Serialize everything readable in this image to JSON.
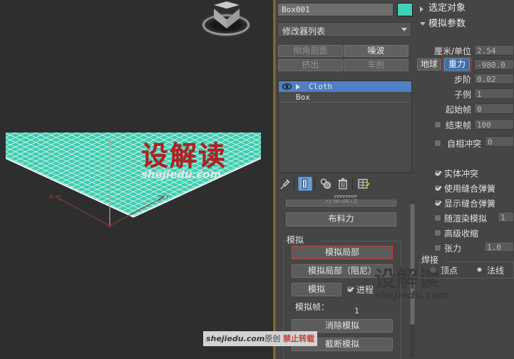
{
  "viewport": {
    "name": "perspective-viewport",
    "viewcube_label": "view-cube",
    "axis_z": "Z",
    "axis_x": "X",
    "axis_y": "Y",
    "mesh_color": "#3fcdb0",
    "mesh_edge_color": "#ffffff",
    "background": "#2e2e2e",
    "watermark_cn": "设解读",
    "watermark_en": "shejiedu.com"
  },
  "bottom_watermark": {
    "en": "shejiedu.com",
    "cn": "原创",
    "red": "禁止转载"
  },
  "command_panel": {
    "object_name": "Box001",
    "object_color": "#3fd3b4",
    "modifier_list_label": "修改器列表",
    "modifier_buttons": [
      {
        "label": "倒角剖面",
        "enabled": false
      },
      {
        "label": "噪波",
        "enabled": true
      },
      {
        "label": "挤出",
        "enabled": false
      },
      {
        "label": "车削",
        "enabled": false
      }
    ],
    "stack": [
      {
        "label": "Cloth",
        "selected": true,
        "has_eye": true,
        "has_expand": true
      },
      {
        "label": "Box",
        "selected": false,
        "has_eye": false,
        "has_expand": false
      }
    ],
    "stack_tools": [
      {
        "name": "pin-stack-icon",
        "active": false
      },
      {
        "name": "show-end-result-icon",
        "active": true
      },
      {
        "name": "make-unique-icon",
        "active": false
      },
      {
        "name": "remove-modifier-icon",
        "active": false
      },
      {
        "name": "configure-modifier-sets-icon",
        "active": false
      }
    ],
    "object_properties_button": "对象属性",
    "cloth_forces_button": "布料力",
    "simulation_group": "模拟",
    "simulate_local_button": "模拟局部",
    "simulate_local_damped_button": "模拟局部（阻尼）",
    "simulate_button": "模拟",
    "progress_checkbox_label": "进程",
    "progress_checked": true,
    "sim_frame_label": "模拟帧：",
    "sim_frame_value": "1",
    "erase_simulation_button": "消除模拟",
    "truncate_simulation_button": "截断模拟",
    "highlight_color": "#e03535"
  },
  "param_panel": {
    "rollout_selected_object": "选定对象",
    "rollout_sim_params": "模拟参数",
    "cm_per_unit_label": "厘米/单位",
    "cm_per_unit_value": "2.54",
    "earth_button": "地球",
    "gravity_button": "重力",
    "gravity_value": "-980.0",
    "step_label": "步阶",
    "step_value": "0.02",
    "subsample_label": "子例",
    "subsample_value": "1",
    "start_frame_label": "起始帧",
    "start_frame_value": "0",
    "end_frame_label": "结束帧",
    "end_frame_value": "100",
    "end_frame_checked": false,
    "self_collision_label": "自相冲突",
    "self_collision_value": "0",
    "self_collision_checked": false,
    "solid_collision_label": "实体冲突",
    "solid_collision_checked": true,
    "use_sewing_springs_label": "使用缝合弹簧",
    "use_sewing_springs_checked": true,
    "show_sewing_springs_label": "显示缝合弹簧",
    "show_sewing_springs_checked": true,
    "sim_on_render_label": "随渲染模拟",
    "sim_on_render_value": "1",
    "sim_on_render_checked": false,
    "advanced_shrink_label": "高级收缩",
    "advanced_shrink_checked": false,
    "tension_label": "张力",
    "tension_value": "1.0",
    "tension_checked": false,
    "weld_group_label": "焊接",
    "weld_vertex_label": "顶点",
    "weld_normal_label": "法线",
    "weld_selected": "法线",
    "watermark_cn": "设解读",
    "watermark_en": "shejiedu.com"
  }
}
